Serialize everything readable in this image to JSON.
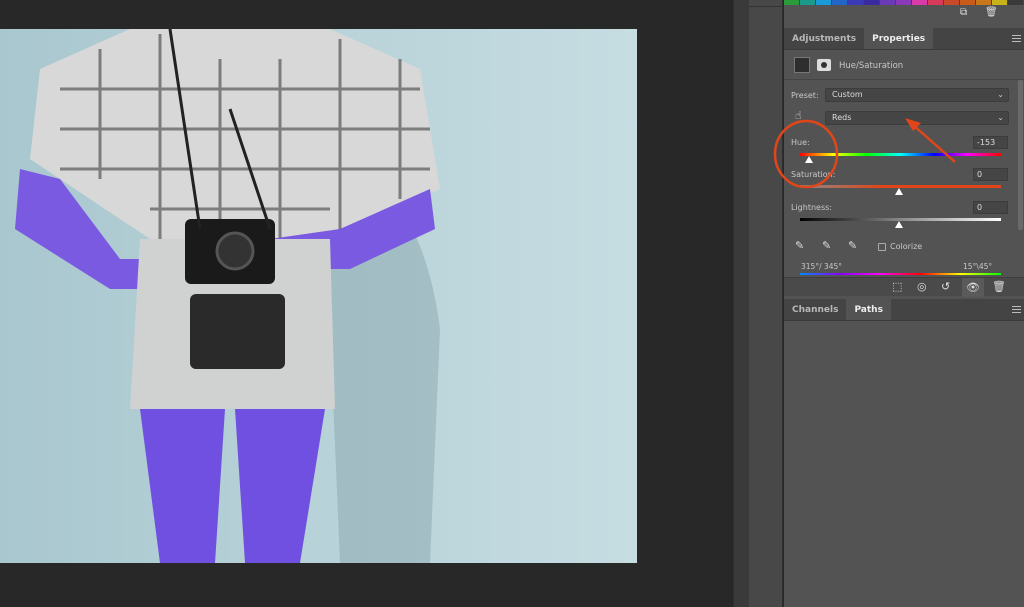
{
  "swatch_colors": [
    "#2a9a3a",
    "#1a9a8a",
    "#1a9ad6",
    "#2266c8",
    "#3a3ab8",
    "#3a2aa0",
    "#6a3ab8",
    "#8a3ab8",
    "#d83aa8",
    "#d83a5a",
    "#c84a2a",
    "#c85a1a",
    "#c8781a",
    "#c8b41a",
    "#3a3a3a"
  ],
  "panel_tabs": {
    "adjustments": "Adjustments",
    "properties": "Properties"
  },
  "properties": {
    "adjustment_name": "Hue/Saturation",
    "preset_label": "Preset:",
    "preset_value": "Custom",
    "channel_value": "Reds",
    "hue_label": "Hue:",
    "hue_value": "-153",
    "saturation_label": "Saturation:",
    "saturation_value": "0",
    "lightness_label": "Lightness:",
    "lightness_value": "0",
    "colorize_label": "Colorize",
    "colorize_checked": false,
    "range_left": "315°/ 345°",
    "range_right": "15°\\45°"
  },
  "bottom_tabs": {
    "channels": "Channels",
    "paths": "Paths"
  },
  "annotation_color": "#e0461a"
}
